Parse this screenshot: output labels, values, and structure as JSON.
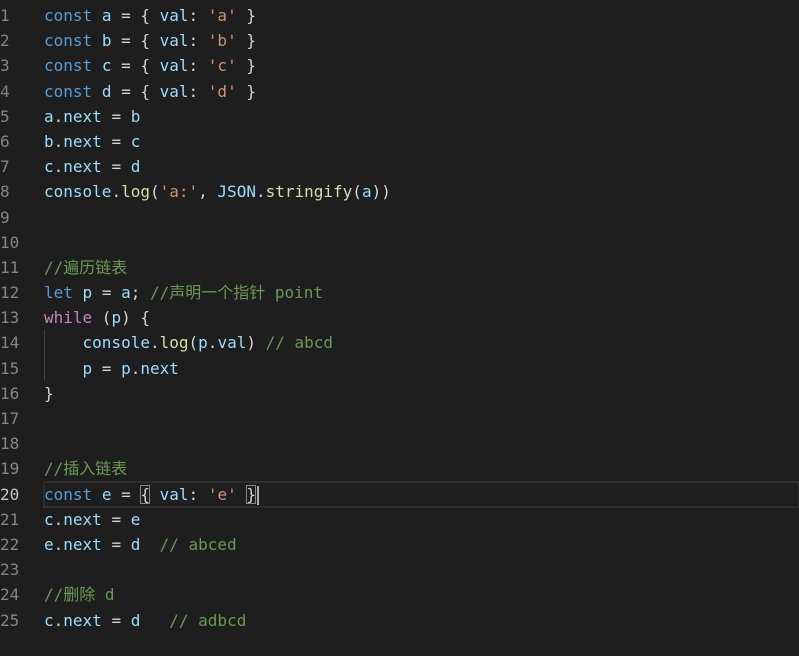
{
  "editor": {
    "current_line": 20,
    "theme_colors": {
      "background": "#1e1e1e",
      "keyword": "#569cd6",
      "control": "#c586c0",
      "variable": "#9cdcfe",
      "string": "#ce9178",
      "function": "#dcdcaa",
      "comment": "#6a9955",
      "line_number": "#858585"
    },
    "lines": [
      {
        "number": "1",
        "tokens": [
          [
            "kw",
            "const"
          ],
          [
            "op",
            " "
          ],
          [
            "var",
            "a"
          ],
          [
            "op",
            " = { "
          ],
          [
            "prop",
            "val"
          ],
          [
            "op",
            ": "
          ],
          [
            "str",
            "'a'"
          ],
          [
            "op",
            " }"
          ]
        ]
      },
      {
        "number": "2",
        "tokens": [
          [
            "kw",
            "const"
          ],
          [
            "op",
            " "
          ],
          [
            "var",
            "b"
          ],
          [
            "op",
            " = { "
          ],
          [
            "prop",
            "val"
          ],
          [
            "op",
            ": "
          ],
          [
            "str",
            "'b'"
          ],
          [
            "op",
            " }"
          ]
        ]
      },
      {
        "number": "3",
        "tokens": [
          [
            "kw",
            "const"
          ],
          [
            "op",
            " "
          ],
          [
            "var",
            "c"
          ],
          [
            "op",
            " = { "
          ],
          [
            "prop",
            "val"
          ],
          [
            "op",
            ": "
          ],
          [
            "str",
            "'c'"
          ],
          [
            "op",
            " }"
          ]
        ]
      },
      {
        "number": "4",
        "tokens": [
          [
            "kw",
            "const"
          ],
          [
            "op",
            " "
          ],
          [
            "var",
            "d"
          ],
          [
            "op",
            " = { "
          ],
          [
            "prop",
            "val"
          ],
          [
            "op",
            ": "
          ],
          [
            "str",
            "'d'"
          ],
          [
            "op",
            " }"
          ]
        ]
      },
      {
        "number": "5",
        "tokens": [
          [
            "var",
            "a"
          ],
          [
            "op",
            "."
          ],
          [
            "prop",
            "next"
          ],
          [
            "op",
            " = "
          ],
          [
            "var",
            "b"
          ]
        ]
      },
      {
        "number": "6",
        "tokens": [
          [
            "var",
            "b"
          ],
          [
            "op",
            "."
          ],
          [
            "prop",
            "next"
          ],
          [
            "op",
            " = "
          ],
          [
            "var",
            "c"
          ]
        ]
      },
      {
        "number": "7",
        "tokens": [
          [
            "var",
            "c"
          ],
          [
            "op",
            "."
          ],
          [
            "prop",
            "next"
          ],
          [
            "op",
            " = "
          ],
          [
            "var",
            "d"
          ]
        ]
      },
      {
        "number": "8",
        "tokens": [
          [
            "glob",
            "console"
          ],
          [
            "op",
            "."
          ],
          [
            "fn",
            "log"
          ],
          [
            "op",
            "("
          ],
          [
            "str",
            "'a:'"
          ],
          [
            "op",
            ", "
          ],
          [
            "glob",
            "JSON"
          ],
          [
            "op",
            "."
          ],
          [
            "fn",
            "stringify"
          ],
          [
            "op",
            "("
          ],
          [
            "var",
            "a"
          ],
          [
            "op",
            "))"
          ]
        ]
      },
      {
        "number": "9",
        "tokens": []
      },
      {
        "number": "10",
        "tokens": []
      },
      {
        "number": "11",
        "tokens": [
          [
            "cmt",
            "//遍历链表"
          ]
        ]
      },
      {
        "number": "12",
        "tokens": [
          [
            "kw",
            "let"
          ],
          [
            "op",
            " "
          ],
          [
            "var",
            "p"
          ],
          [
            "op",
            " = "
          ],
          [
            "var",
            "a"
          ],
          [
            "op",
            "; "
          ],
          [
            "cmt",
            "//声明一个指针 point"
          ]
        ]
      },
      {
        "number": "13",
        "tokens": [
          [
            "ctl",
            "while"
          ],
          [
            "op",
            " ("
          ],
          [
            "var",
            "p"
          ],
          [
            "op",
            ") {"
          ]
        ]
      },
      {
        "number": "14",
        "indent": true,
        "tokens": [
          [
            "op",
            "    "
          ],
          [
            "glob",
            "console"
          ],
          [
            "op",
            "."
          ],
          [
            "fn",
            "log"
          ],
          [
            "op",
            "("
          ],
          [
            "var",
            "p"
          ],
          [
            "op",
            "."
          ],
          [
            "prop",
            "val"
          ],
          [
            "op",
            ") "
          ],
          [
            "cmt",
            "// abcd"
          ]
        ]
      },
      {
        "number": "15",
        "indent": true,
        "tokens": [
          [
            "op",
            "    "
          ],
          [
            "var",
            "p"
          ],
          [
            "op",
            " = "
          ],
          [
            "var",
            "p"
          ],
          [
            "op",
            "."
          ],
          [
            "prop",
            "next"
          ]
        ]
      },
      {
        "number": "16",
        "tokens": [
          [
            "op",
            "}"
          ]
        ]
      },
      {
        "number": "17",
        "tokens": []
      },
      {
        "number": "18",
        "tokens": []
      },
      {
        "number": "19",
        "tokens": [
          [
            "cmt",
            "//插入链表"
          ]
        ]
      },
      {
        "number": "20",
        "tokens": [
          [
            "kw",
            "const"
          ],
          [
            "op",
            " "
          ],
          [
            "var",
            "e"
          ],
          [
            "op",
            " = "
          ],
          [
            "match",
            "{"
          ],
          [
            "op",
            " "
          ],
          [
            "prop",
            "val"
          ],
          [
            "op",
            ": "
          ],
          [
            "str",
            "'e'"
          ],
          [
            "op",
            " "
          ],
          [
            "match",
            "}"
          ],
          [
            "cursor",
            ""
          ]
        ]
      },
      {
        "number": "21",
        "tokens": [
          [
            "var",
            "c"
          ],
          [
            "op",
            "."
          ],
          [
            "prop",
            "next"
          ],
          [
            "op",
            " = "
          ],
          [
            "var",
            "e"
          ]
        ]
      },
      {
        "number": "22",
        "tokens": [
          [
            "var",
            "e"
          ],
          [
            "op",
            "."
          ],
          [
            "prop",
            "next"
          ],
          [
            "op",
            " = "
          ],
          [
            "var",
            "d"
          ],
          [
            "op",
            "  "
          ],
          [
            "cmt",
            "// abced"
          ]
        ]
      },
      {
        "number": "23",
        "tokens": []
      },
      {
        "number": "24",
        "tokens": [
          [
            "cmt",
            "//删除 d"
          ]
        ]
      },
      {
        "number": "25",
        "tokens": [
          [
            "var",
            "c"
          ],
          [
            "op",
            "."
          ],
          [
            "prop",
            "next"
          ],
          [
            "op",
            " = "
          ],
          [
            "var",
            "d"
          ],
          [
            "op",
            "   "
          ],
          [
            "cmt",
            "// adbcd"
          ]
        ]
      }
    ]
  }
}
